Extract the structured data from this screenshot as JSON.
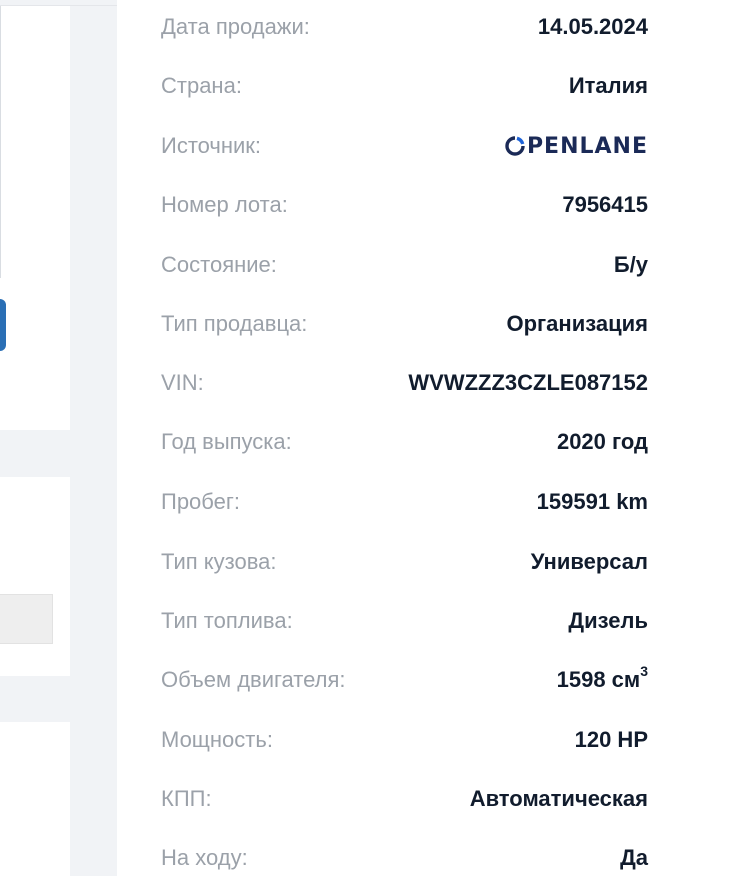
{
  "details": [
    {
      "label": "Дата продажи:",
      "value": "14.05.2024"
    },
    {
      "label": "Страна:",
      "value": "Италия"
    },
    {
      "label": "Источник:",
      "value": "PENLANE",
      "logo": "openlane-logo",
      "logo_color": "#1b2a57",
      "logo_accent": "#1e63d8"
    },
    {
      "label": "Номер лота:",
      "value": "7956415"
    },
    {
      "label": "Состояние:",
      "value": "Б/у"
    },
    {
      "label": "Тип продавца:",
      "value": "Организация"
    },
    {
      "label": "VIN:",
      "value": "WVWZZZ3CZLE087152"
    },
    {
      "label": "Год выпуска:",
      "value": "2020 год"
    },
    {
      "label": "Пробег:",
      "value": "159591 km"
    },
    {
      "label": "Тип кузова:",
      "value": "Универсал"
    },
    {
      "label": "Тип топлива:",
      "value": "Дизель"
    },
    {
      "label": "Объем двигателя:",
      "value": "1598 см",
      "sup": "3"
    },
    {
      "label": "Мощность:",
      "value": "120 HP"
    },
    {
      "label": "КПП:",
      "value": "Автоматическая"
    },
    {
      "label": "На ходу:",
      "value": "Да"
    }
  ],
  "colors": {
    "label": "#9ba1a9",
    "value": "#111c2d",
    "background": "#f1f3f6",
    "card": "#ffffff",
    "accent_tab": "#2a6fb5"
  }
}
